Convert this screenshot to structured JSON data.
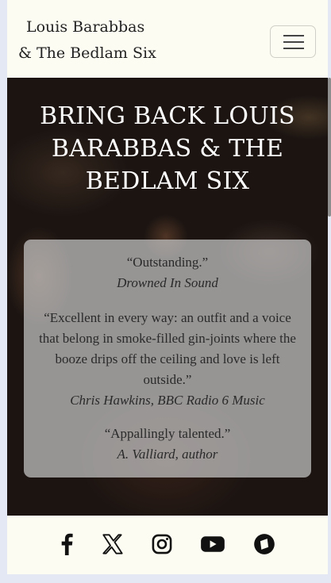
{
  "navbar": {
    "brand_line1": "Louis Barabbas",
    "brand_line2": "& The Bedlam Six",
    "toggler_icon": "hamburger-menu-icon"
  },
  "hero": {
    "title": "BRING BACK LOUIS BARABBAS & THE BEDLAM SIX",
    "quotes": [
      {
        "text": "“Outstanding.”",
        "source": "Drowned In Sound"
      },
      {
        "text": "“Excellent in every way: an outfit and a voice that belong in smoke-filled gin-joints where the booze drips off the ceiling and love is left outside.”",
        "source": "Chris Hawkins, BBC Radio 6 Music"
      },
      {
        "text": "“Appallingly talented.”",
        "source": "A. Valliard, author"
      }
    ]
  },
  "footer": {
    "social_icons": [
      "facebook-icon",
      "x-twitter-icon",
      "instagram-icon",
      "youtube-icon",
      "bandcamp-icon"
    ]
  },
  "colors": {
    "navbar_bg": "#fdfcf2",
    "page_bg": "#e3e8f4",
    "hero_text": "#ffffff",
    "quote_panel": "#c8c8c8"
  }
}
